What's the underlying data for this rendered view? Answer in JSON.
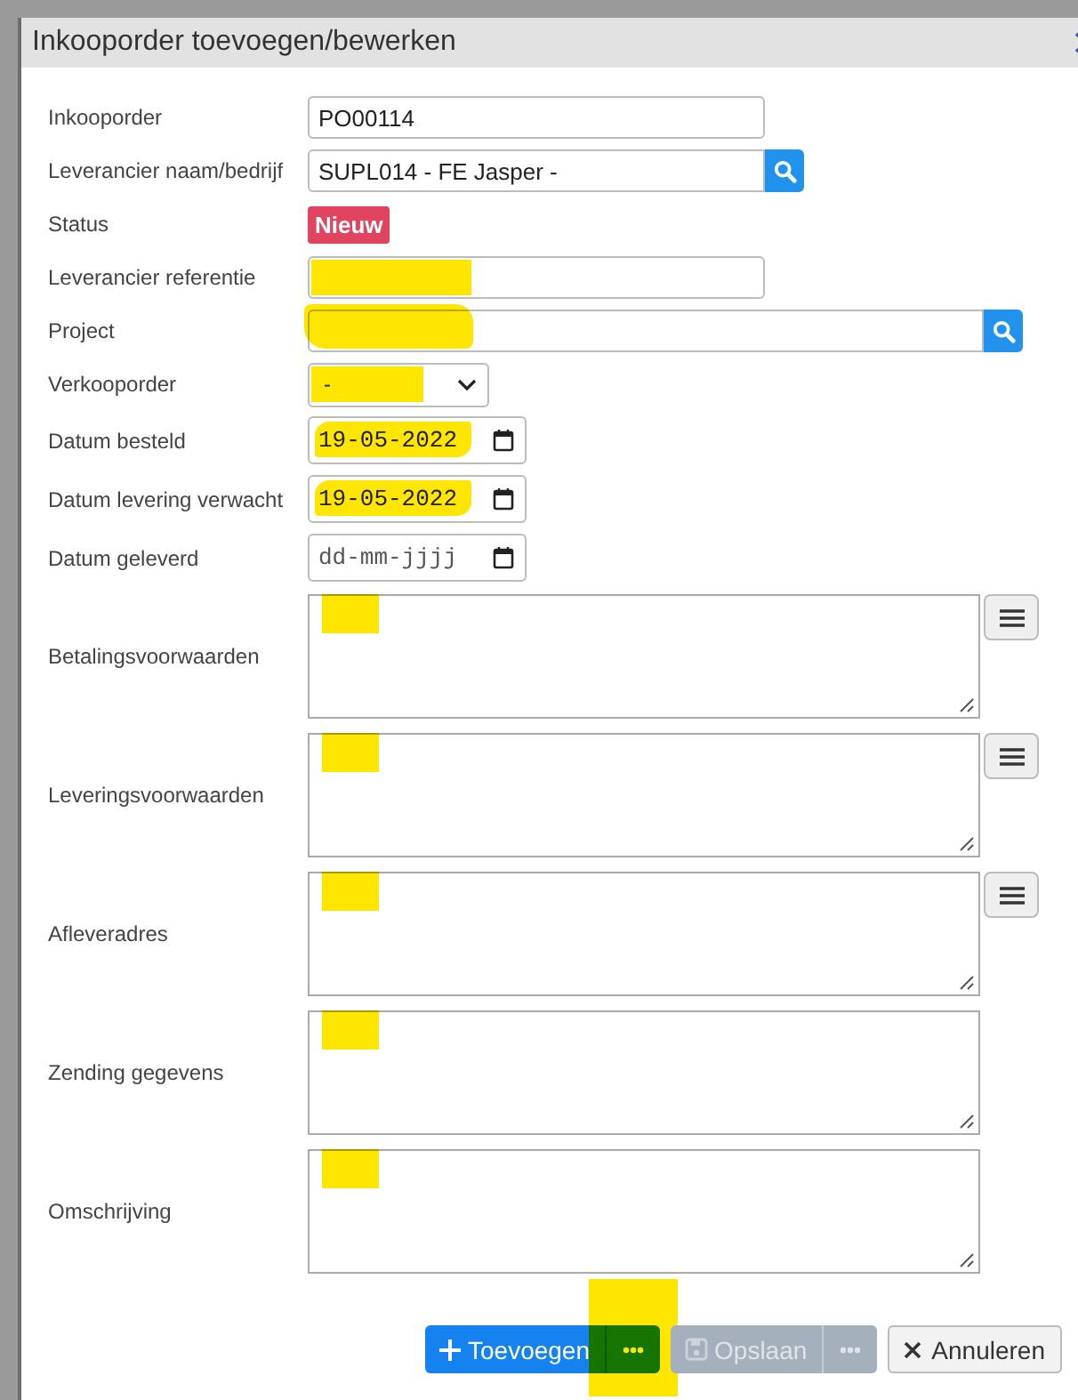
{
  "window": {
    "title": "Inkooporder toevoegen/bewerken"
  },
  "fields": [
    {
      "kind": "text",
      "label": "Inkooporder",
      "value": "PO00114"
    },
    {
      "kind": "lookup",
      "label": "Leverancier naam/bedrijf",
      "value": "SUPL014 - FE Jasper -"
    },
    {
      "kind": "badge",
      "label": "Status",
      "value": "Nieuw"
    },
    {
      "kind": "text",
      "label": "Leverancier referentie",
      "highlighted": true
    },
    {
      "kind": "lookup",
      "label": "Project",
      "highlighted": true,
      "wide": true
    },
    {
      "kind": "select",
      "label": "Verkooporder",
      "value": "-",
      "highlighted": true
    },
    {
      "kind": "date",
      "label": "Datum besteld",
      "value": "19-05-2022",
      "highlighted": true
    },
    {
      "kind": "date",
      "label": "Datum levering verwacht",
      "value": "19-05-2022",
      "highlighted": true
    },
    {
      "kind": "date",
      "label": "Datum geleverd",
      "placeholder": "dd-mm-jjjj"
    },
    {
      "kind": "textarea",
      "label": "Betalingsvoorwaarden",
      "menu": true,
      "highlighted": true
    },
    {
      "kind": "textarea",
      "label": "Leveringsvoorwaarden",
      "menu": true,
      "highlighted": true
    },
    {
      "kind": "textarea",
      "label": "Afleveradres",
      "menu": true,
      "highlighted": true
    },
    {
      "kind": "textarea",
      "label": "Zending gegevens",
      "highlighted": true
    },
    {
      "kind": "textarea",
      "label": "Omschrijving",
      "highlighted": true
    }
  ],
  "buttons": [
    {
      "kind": "add",
      "label": "Toevoegen",
      "disabled": false,
      "highlighted": true
    },
    {
      "kind": "save",
      "label": "Opslaan",
      "disabled": true
    },
    {
      "kind": "cancel",
      "label": "Annuleren"
    }
  ]
}
